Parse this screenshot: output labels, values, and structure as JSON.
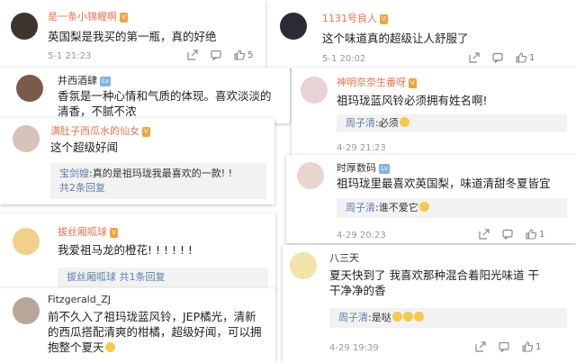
{
  "comments": [
    {
      "user": "是一条小锦鲤啊",
      "text": "英国梨是我买的第一瓶，真的好绝",
      "time": "5-1 21:23",
      "likes": "5"
    },
    {
      "user": "1131号良人",
      "text": "这个味道真的超级让人舒服了",
      "time": "5-1 20:02",
      "likes": "1"
    },
    {
      "user": "井西酒肆",
      "text_line1": "香氛是一种心情和气质的体现。喜欢淡淡的",
      "text_line2": "清香，不腻不浓"
    },
    {
      "user": "神明奈奈生番呀",
      "text": "祖玛珑蓝风铃必须拥有姓名啊!",
      "reply_user": "周子清",
      "reply_text": ":必须",
      "time": "4-29 21:23",
      "likes": "1"
    },
    {
      "user": "满肚子西瓜水的仙女",
      "text": "这个超级好闻",
      "reply_user": "宝剑嫂",
      "reply_text": ":真的是祖玛珑我最喜欢的一款! !",
      "reply_more": "共2条回复"
    },
    {
      "user": "时厚数码",
      "text": "祖玛珑里最喜欢英国梨，味道清甜冬夏皆宜",
      "reply_user": "周子清",
      "reply_text": ":谁不爱它",
      "time": "4-29 20:23",
      "likes": "1"
    },
    {
      "user": "拔丝厢呱球",
      "text": "我爱祖马龙的橙花! ! ! ! ! !",
      "reply_user": "拔丝厢呱球",
      "reply_more": "共1条回复"
    },
    {
      "user": "八三天",
      "text_line1": "夏天快到了 我喜欢那种混合着阳光味道 干",
      "text_line2": "干净净的香",
      "reply_user": "周子清",
      "reply_text": ":是哒",
      "time": "4-29 19:39",
      "likes": "1"
    },
    {
      "user": "Fitzgerald_ZJ",
      "text_line1": "前不久入了祖玛珑蓝风铃，JEP橘光，清新",
      "text_line2": "的西瓜搭配清爽的柑橘，超级好闻，可以拥",
      "text_line3": "抱整个夏天"
    }
  ]
}
